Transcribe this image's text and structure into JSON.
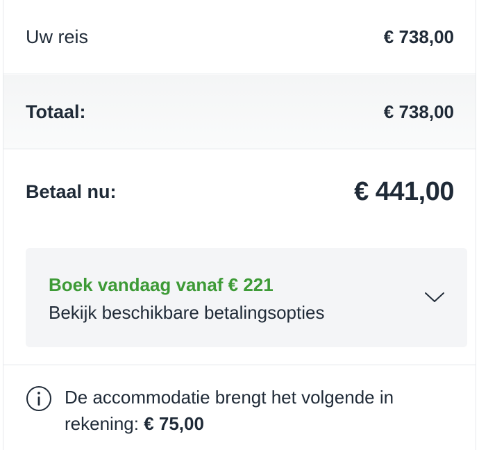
{
  "summary": {
    "trip_label": "Uw reis",
    "trip_amount": "€ 738,00",
    "total_label": "Totaal:",
    "total_amount": "€ 738,00",
    "pay_now_label": "Betaal nu:",
    "pay_now_amount": "€ 441,00"
  },
  "payment_options": {
    "title": "Boek vandaag vanaf € 221",
    "subtitle": "Bekijk beschikbare betalingsopties",
    "chevron_icon": "chevron-down-icon"
  },
  "info": {
    "icon": "info-icon",
    "text": "De accommodatie brengt het volgende in rekening: ",
    "amount": "€ 75,00"
  },
  "colors": {
    "accent_green": "#3d9a36",
    "text_dark": "#1f2a37",
    "panel_bg": "#f4f5f7"
  }
}
